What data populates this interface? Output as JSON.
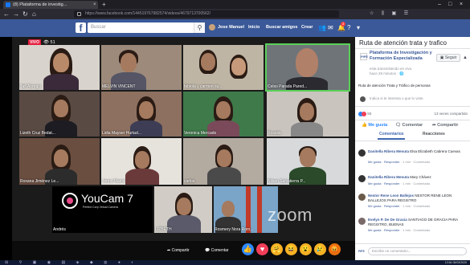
{
  "browser": {
    "tab_title": "(8) Plataforma de investig...",
    "url": "https://www.facebook.com/144519767982574/videos/4679713700562/"
  },
  "facebook": {
    "search_placeholder": "Buscar",
    "user_name": "Jose Manuel",
    "nav": [
      "Inicio",
      "Buscar amigos",
      "Crear"
    ],
    "notification_count": "3",
    "brand_color": "#3b5998"
  },
  "video": {
    "live_label": "VIVO",
    "viewer_count": "51",
    "tiles": [
      {
        "name": "Tafi Abregio"
      },
      {
        "name": "MELVIN VINCENT"
      },
      {
        "name": "fabiola y carmen su..."
      },
      {
        "name": "Celso Parada Pared..."
      },
      {
        "name": "Lizeth Cruz Bedat..."
      },
      {
        "name": "Lidia Mayser Hurtad..."
      },
      {
        "name": "Veronica Mercado"
      },
      {
        "name": "Rosalia"
      },
      {
        "name": "Roxana Jiménez Le..."
      },
      {
        "name": "Jenny Mamá"
      },
      {
        "name": "carlos"
      },
      {
        "name": "Nilsen Salvatierra P..."
      },
      {
        "name": "Andrés"
      },
      {
        "name": "LIZBETH"
      },
      {
        "name": "Rosmery Nora Rom..."
      }
    ],
    "youcam_brand": "YouCam 7",
    "youcam_sub": "Perfect Corp Virtual Camera",
    "zoom_watermark": "zoom",
    "share_label": "Compartir",
    "comment_label": "Comentar"
  },
  "sidebar": {
    "title": "Ruta de atención trata y trafico",
    "page_name": "Plataforma de Investigación y Formación Especializada",
    "page_meta_1": "esta transmitiendo en vivo.",
    "page_meta_2": "hace 29 minutos · 🌐",
    "follow_label": "Seguir",
    "description": "Ruta de atención Trata y Tráfico de personas",
    "ghost_comment": "Indica si te interesa o que lo viste.",
    "reactions_count": "93",
    "shares_count": "13 veces compartido",
    "actions": [
      "Me gusta",
      "Comentar",
      "Compartir"
    ],
    "tabs": [
      "Comentarios",
      "Reacciones"
    ],
    "comments": [
      {
        "name": "Danitella Ribera Menuta",
        "text": "Elsa Elizabeth Cabrera Cuevas",
        "meta_like": "Me gusta",
        "meta_reply": "Responder",
        "meta_time": "1 min",
        "meta_extra": "Comentado"
      },
      {
        "name": "Danitella Ribera Menuta",
        "text": "Mary Chávez",
        "meta_like": "Me gusta",
        "meta_reply": "Responder",
        "meta_time": "1 min",
        "meta_extra": "Comentado"
      },
      {
        "name": "Nestor Rene Leon Ballejos",
        "text": "NESTOR RENE LEON BALLEJOS PARA REGISTRO",
        "meta_like": "Me gusta",
        "meta_reply": "Responder",
        "meta_time": "1 min",
        "meta_extra": "Comentado"
      },
      {
        "name": "Evelyn P. De De Gracia",
        "text": "SANTIAGO DE GRACIA PARA REGISTRO, BUENAS",
        "meta_like": "Me gusta",
        "meta_reply": "Responder",
        "meta_time": "1 min",
        "meta_extra": "Comentado"
      }
    ],
    "write_placeholder": "Escribe un comentario...",
    "write_avatar": "PIFE"
  },
  "taskbar": {
    "time": "13:54",
    "date": "05/03/2020"
  }
}
